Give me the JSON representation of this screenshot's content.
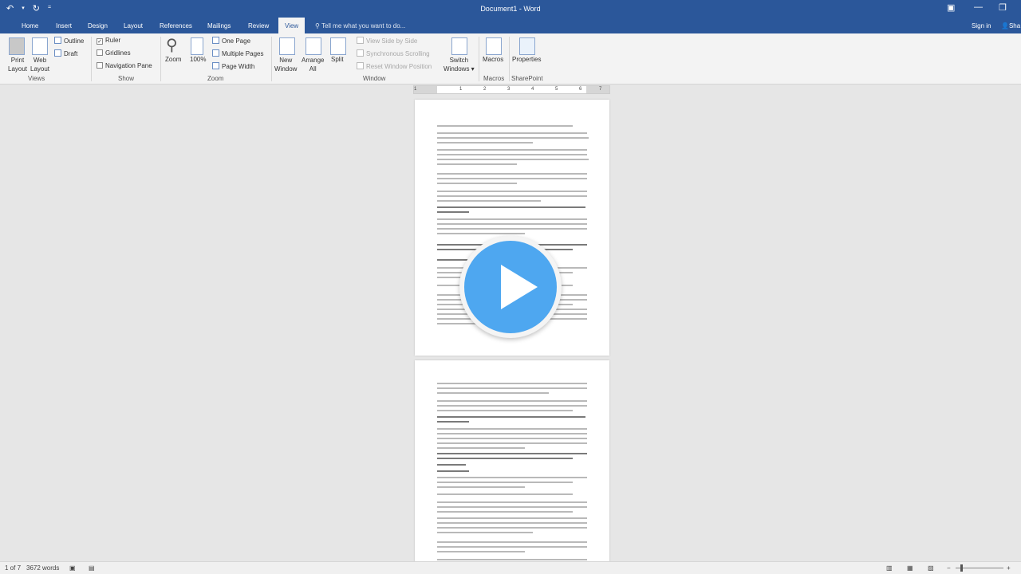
{
  "window": {
    "title": "Document1 - Word",
    "signin": "Sign in",
    "share": "Sha"
  },
  "tabs": [
    "Home",
    "Insert",
    "Design",
    "Layout",
    "References",
    "Mailings",
    "Review",
    "View"
  ],
  "active_tab": "View",
  "tellme": "Tell me what you want to do...",
  "ribbon": {
    "views": {
      "print_layout": [
        "Print",
        "Layout"
      ],
      "web_layout": [
        "Web",
        "Layout"
      ],
      "outline": "Outline",
      "draft": "Draft",
      "label": "Views"
    },
    "show": {
      "ruler": "Ruler",
      "gridlines": "Gridlines",
      "navigation_pane": "Navigation Pane",
      "label": "Show"
    },
    "zoom": {
      "zoom": "Zoom",
      "hundred": "100%",
      "one_page": "One Page",
      "multiple_pages": "Multiple Pages",
      "page_width": "Page Width",
      "label": "Zoom"
    },
    "window": {
      "new_window": [
        "New",
        "Window"
      ],
      "arrange_all": [
        "Arrange",
        "All"
      ],
      "split": "Split",
      "side_by_side": "View Side by Side",
      "sync_scroll": "Synchronous Scrolling",
      "reset_position": "Reset Window Position",
      "switch_windows": [
        "Switch",
        "Windows ▾"
      ],
      "label": "Window"
    },
    "macros": {
      "button": "Macros",
      "label": "Macros"
    },
    "sharepoint": {
      "button": "Properties",
      "label": "SharePoint"
    }
  },
  "ruler": {
    "ticks": [
      "1",
      "1",
      "2",
      "3",
      "4",
      "5",
      "6",
      "7"
    ]
  },
  "status": {
    "page": "1 of 7",
    "words": "3672 words"
  },
  "colors": {
    "brand": "#2b579a",
    "play": "#4ea7f0"
  }
}
